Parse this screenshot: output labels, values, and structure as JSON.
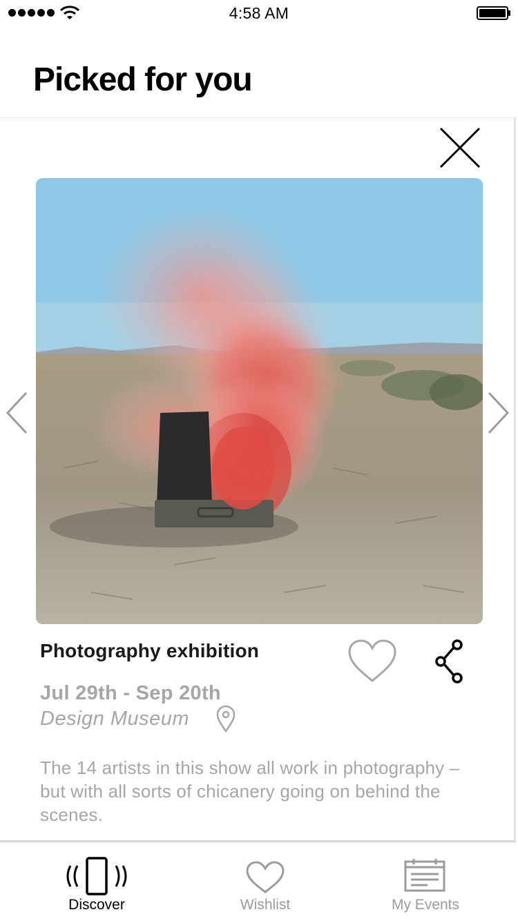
{
  "status_bar": {
    "time": "4:58 AM",
    "signal_icon": "signal-dots-icon",
    "wifi_icon": "wifi-icon",
    "battery_icon": "battery-icon"
  },
  "header": {
    "title": "Picked for you"
  },
  "card": {
    "close_icon": "close-icon",
    "prev_icon": "chevron-left-icon",
    "next_icon": "chevron-right-icon",
    "image_description_icon": "event-photo",
    "title": "Photography exhibition",
    "dates": "Jul 29th - Sep 20th",
    "venue": "Design Museum",
    "like_icon": "heart-icon",
    "share_icon": "share-icon",
    "location_icon": "location-pin-icon",
    "description": "The 14 artists in this show all work in photography – but with all sorts of chicanery going on behind the scenes."
  },
  "tab_bar": {
    "active_color": "#000000",
    "inactive_color": "#9b9b9b",
    "tabs": [
      {
        "label": "Discover",
        "icon": "phone-vibrate-icon",
        "active": true
      },
      {
        "label": "Wishlist",
        "icon": "heart-icon",
        "active": false
      },
      {
        "label": "My Events",
        "icon": "calendar-icon",
        "active": false
      }
    ]
  }
}
